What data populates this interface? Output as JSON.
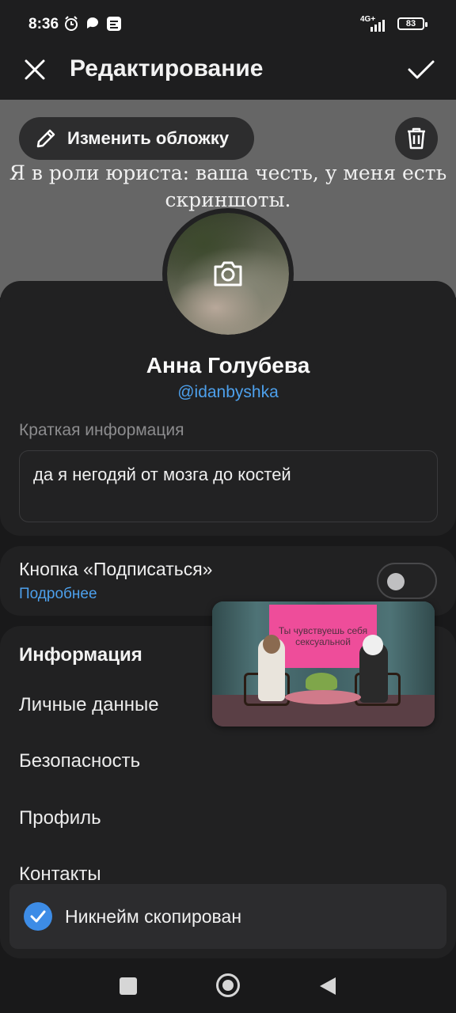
{
  "status_bar": {
    "time": "8:36",
    "network": "4G+",
    "battery": "83"
  },
  "app_bar": {
    "title": "Редактирование",
    "close_icon": "close-icon",
    "confirm_icon": "check-icon"
  },
  "cover": {
    "quote": "Я в роли юриста: ваша честь, у меня есть скриншоты.",
    "change_cover_label": "Изменить обложку",
    "delete_icon": "trash-icon"
  },
  "profile": {
    "name": "Анна Голубева",
    "username": "@idanbyshka",
    "bio_label": "Краткая информация",
    "bio_value": "да я негодяй от мозга до костей"
  },
  "subscribe": {
    "label": "Кнопка «Подписаться»",
    "more_link": "Подробнее",
    "enabled": false
  },
  "info": {
    "title": "Информация",
    "items": [
      "Личные данные",
      "Безопасность",
      "Профиль",
      "Контакты"
    ]
  },
  "video_overlay": {
    "screen_text": "Ты чувствуешь себя сексуальной"
  },
  "toast": {
    "message": "Никнейм скопирован"
  },
  "colors": {
    "accent": "#4da0ec",
    "background": "#19191a",
    "card": "#212122",
    "toast_check": "#3d8ce6"
  }
}
